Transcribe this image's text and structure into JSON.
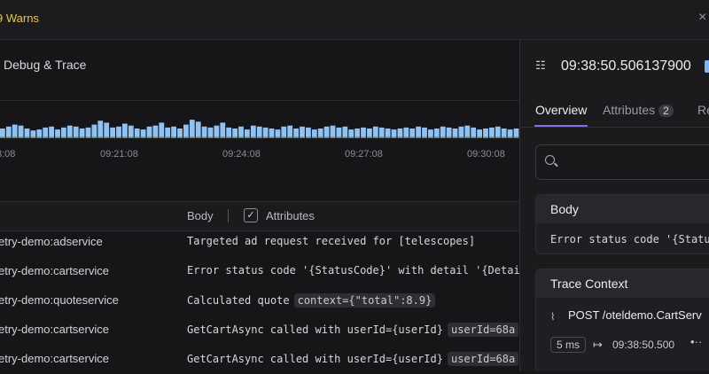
{
  "banner": {
    "warn_text": "9 Warns",
    "close_label": "×"
  },
  "section": {
    "title": "Debug & Trace"
  },
  "histogram": {
    "x_ticks": [
      "3:08",
      "09:21:08",
      "09:24:08",
      "09:27:08",
      "09:30:08"
    ],
    "bar_color": "#8fc3f5",
    "shadow_color": "#5d7f6a",
    "values": [
      10,
      12,
      14,
      13,
      10,
      8,
      9,
      11,
      12,
      9,
      11,
      13,
      12,
      10,
      11,
      14,
      18,
      16,
      11,
      12,
      15,
      13,
      10,
      9,
      12,
      13,
      16,
      11,
      12,
      10,
      14,
      19,
      17,
      12,
      11,
      13,
      16,
      11,
      10,
      12,
      9,
      13,
      12,
      11,
      10,
      9,
      12,
      13,
      10,
      12,
      11,
      9,
      10,
      12,
      13,
      11,
      12,
      9,
      10,
      11,
      10,
      12,
      11,
      10,
      9,
      10,
      11,
      10,
      12,
      11,
      9,
      10,
      12,
      11,
      10,
      12,
      13,
      11,
      9,
      10,
      11,
      12,
      10,
      9,
      10,
      11
    ]
  },
  "log_header": {
    "body_label": "Body",
    "attributes_label": "Attributes",
    "check_mark": "✓"
  },
  "rows": [
    {
      "service": "etry-demo:adservice",
      "body": "Targeted ad request received for [telescopes]",
      "chip": ""
    },
    {
      "service": "etry-demo:cartservice",
      "body": "Error status code '{StatusCode}' with detail '{Detail}'",
      "chip": ""
    },
    {
      "service": "etry-demo:quoteservice",
      "body": "Calculated quote",
      "chip": "context={\"total\":8.9}"
    },
    {
      "service": "etry-demo:cartservice",
      "body": "GetCartAsync called with userId={userId}",
      "chip": "userId=68a"
    },
    {
      "service": "etry-demo:cartservice",
      "body": "GetCartAsync called with userId={userId}",
      "chip": "userId=68a"
    }
  ],
  "panel": {
    "icon": "☷",
    "timestamp": "09:38:50.506137900",
    "tabs": [
      {
        "label": "Overview"
      },
      {
        "label": "Attributes",
        "count": "2"
      },
      {
        "label": "Re"
      }
    ],
    "search": {
      "placeholder": ""
    },
    "body_card": {
      "title": "Body",
      "text": "Error status code '{Statu"
    },
    "trace_card": {
      "title": "Trace Context",
      "link_icon": "⌇",
      "endpoint": "POST /oteldemo.CartServ",
      "duration": "5 ms",
      "arrow": "↦",
      "start_time": "09:38:50.500",
      "more": "•··"
    }
  }
}
